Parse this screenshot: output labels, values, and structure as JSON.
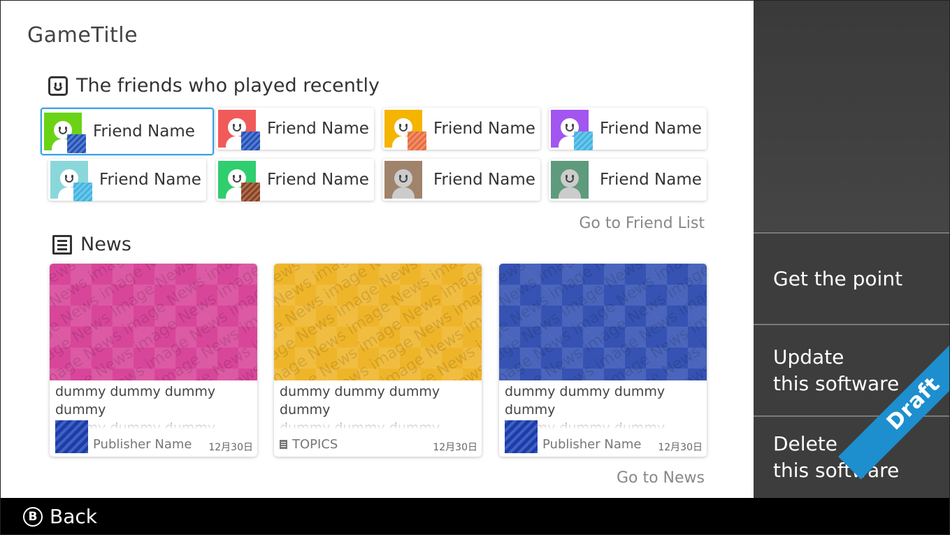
{
  "game_title": "GameTitle",
  "friends": {
    "heading": "The friends who played recently",
    "icon": "smiley-icon",
    "items": [
      {
        "name": "Friend Name",
        "color": "#6ad316",
        "game_color": "#1f4fb8",
        "selected": true
      },
      {
        "name": "Friend Name",
        "color": "#f15a5a",
        "game_color": "#1f4fb8",
        "selected": false
      },
      {
        "name": "Friend Name",
        "color": "#f4b400",
        "game_color": "#e86a3a",
        "selected": false
      },
      {
        "name": "Friend Name",
        "color": "#a355f0",
        "game_color": "#3fb3e0",
        "selected": false
      },
      {
        "name": "Friend Name",
        "color": "#8ad7da",
        "game_color": "#3fb3e0",
        "selected": false
      },
      {
        "name": "Friend Name",
        "color": "#2fce6e",
        "game_color": "#8a3e1c",
        "selected": false
      },
      {
        "name": "Friend Name",
        "color": "#a0836b",
        "game_color": null,
        "selected": false
      },
      {
        "name": "Friend Name",
        "color": "#5e9a7c",
        "game_color": null,
        "selected": false
      }
    ],
    "link": "Go to Friend List"
  },
  "news": {
    "heading": "News",
    "icon": "news-icon",
    "image_text": "News image",
    "items": [
      {
        "color": "#d8469a",
        "lines": [
          "dummy dummy dummy dummy",
          "dummy dummy dummy dummy",
          "dummy dummy dummy"
        ],
        "source_type": "publisher",
        "source": "Publisher Name",
        "date": "12月30日"
      },
      {
        "color": "#efb52a",
        "lines": [
          "dummy dummy dummy dummy",
          "dummy dummy dummy dummy",
          "dummy dummy dummy dummy"
        ],
        "source_type": "topics",
        "source": "TOPICS",
        "date": "12月30日"
      },
      {
        "color": "#3653b3",
        "lines": [
          "dummy dummy dummy dummy",
          "dummy dummy dummy dummy",
          "dummy dummy dummy"
        ],
        "source_type": "publisher",
        "source": "Publisher Name",
        "date": "12月30日"
      }
    ],
    "link": "Go to News"
  },
  "menu": {
    "items": [
      {
        "label_lines": [
          "Get the point"
        ]
      },
      {
        "label_lines": [
          "Update",
          "this software"
        ]
      },
      {
        "label_lines": [
          "Delete",
          "this software"
        ]
      }
    ]
  },
  "bottom_bar": {
    "button_glyph": "B",
    "back_label": "Back"
  },
  "watermark": "Draft"
}
